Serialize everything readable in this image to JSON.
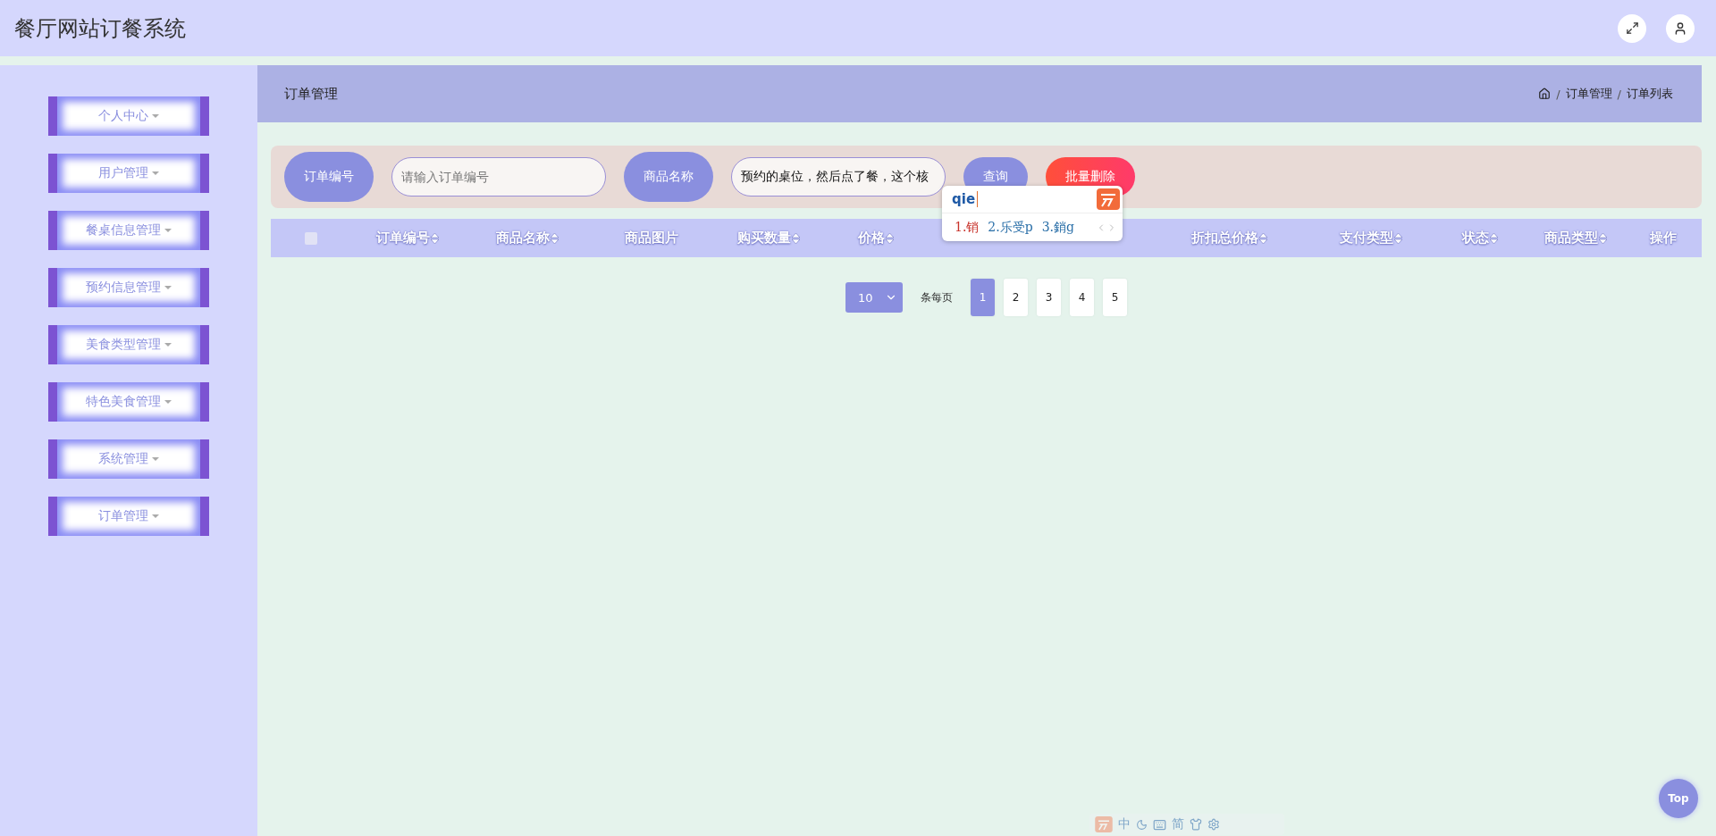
{
  "header": {
    "title": "餐厅网站订餐系统"
  },
  "sidebar": {
    "items": [
      {
        "label": "个人中心"
      },
      {
        "label": "用户管理"
      },
      {
        "label": "餐桌信息管理"
      },
      {
        "label": "预约信息管理"
      },
      {
        "label": "美食类型管理"
      },
      {
        "label": "特色美食管理"
      },
      {
        "label": "系统管理"
      },
      {
        "label": "订单管理"
      }
    ]
  },
  "page_bar": {
    "title": "订单管理",
    "breadcrumb": [
      "订单管理",
      "订单列表"
    ],
    "separator": "/"
  },
  "search": {
    "fields": [
      {
        "label": "订单编号",
        "placeholder": "请输入订单编号"
      },
      {
        "label": "商品名称",
        "value": "预约的桌位，然后点了餐，这个核"
      }
    ],
    "query_button": "查询",
    "delete_button": "批量删除"
  },
  "ime": {
    "composition": "qie",
    "candidates": [
      "1.销",
      "2.乐受p",
      "3.銷g"
    ]
  },
  "table": {
    "columns": [
      {
        "kind": "checkbox",
        "checked": false
      },
      {
        "kind": "sortable",
        "label": "订单编号"
      },
      {
        "kind": "sortable",
        "label": "商品名称"
      },
      {
        "kind": "plain",
        "label": "商品图片"
      },
      {
        "kind": "sortable",
        "label": "购买数量"
      },
      {
        "kind": "sortable",
        "label": "价格"
      },
      {
        "kind": "covered"
      },
      {
        "kind": "covered"
      },
      {
        "kind": "sortable",
        "label": "折扣总价格"
      },
      {
        "kind": "sortable",
        "label": "支付类型"
      },
      {
        "kind": "sortable",
        "label": "状态"
      },
      {
        "kind": "sortable",
        "label": "商品类型"
      },
      {
        "kind": "plain",
        "label": "操作"
      }
    ]
  },
  "pagination": {
    "page_size": "10",
    "page_size_label": "条每页",
    "pages": [
      {
        "label": "1",
        "selected": true
      },
      {
        "label": "2",
        "selected": false
      },
      {
        "label": "3",
        "selected": false
      },
      {
        "label": "4",
        "selected": false
      },
      {
        "label": "5",
        "selected": false
      }
    ]
  },
  "ime_status": [
    "中",
    "简"
  ],
  "top_button": "Top"
}
